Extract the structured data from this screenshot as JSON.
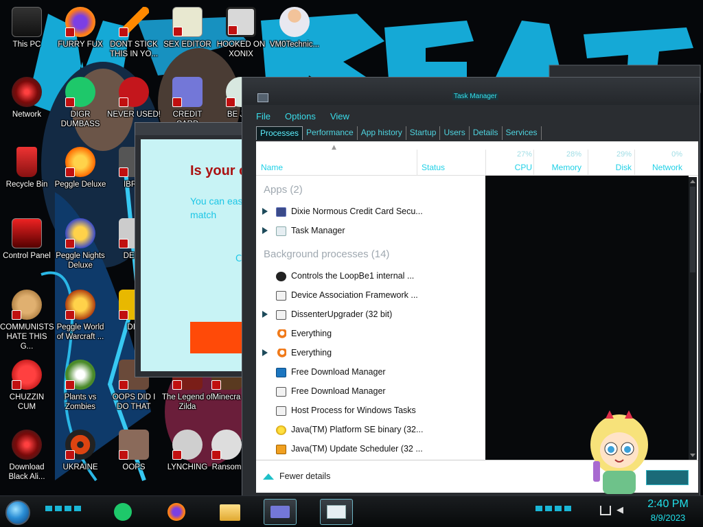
{
  "desktop": {
    "icons": [
      {
        "label": "This PC"
      },
      {
        "label": "FURRY FUX"
      },
      {
        "label": "DONT STICK THIS IN YO..."
      },
      {
        "label": "SEX EDITOR"
      },
      {
        "label": "HOOKED ON XONIX"
      },
      {
        "label": "VM0Technic..."
      },
      {
        "label": "Network"
      },
      {
        "label": "DIGR DUMBASS"
      },
      {
        "label": "NEVER USED!"
      },
      {
        "label": "CREDIT CARD"
      },
      {
        "label": "BE JUS"
      },
      {
        "label": "Recycle Bin"
      },
      {
        "label": "Peggle Deluxe"
      },
      {
        "label": "IBRAI"
      },
      {
        "label": "Control Panel"
      },
      {
        "label": "Peggle Nights Deluxe"
      },
      {
        "label": "DEEZ"
      },
      {
        "label": "COMMUNISTS HATE THIS G..."
      },
      {
        "label": "Peggle World of Warcraft ..."
      },
      {
        "label": "DIE"
      },
      {
        "label": "CHUZZIN CUM"
      },
      {
        "label": "Plants vs Zombies"
      },
      {
        "label": "OOPS DID I DO THAT"
      },
      {
        "label": "The Legend of Zilda"
      },
      {
        "label": "Minecra"
      },
      {
        "label": "Download Black Ali..."
      },
      {
        "label": "UKRAINE"
      },
      {
        "label": "OOPS"
      },
      {
        "label": "LYNCHING"
      },
      {
        "label": "Ransom"
      }
    ],
    "wallpaper_text": "NO REACT"
  },
  "background_window": {
    "heading": "Is your c",
    "body": "You can eas here and we have match",
    "small": "C"
  },
  "task_manager": {
    "title": "Task Manager",
    "menu": [
      "File",
      "Options",
      "View"
    ],
    "tabs": [
      "Processes",
      "Performance",
      "App history",
      "Startup",
      "Users",
      "Details",
      "Services"
    ],
    "active_tab": "Processes",
    "columns": {
      "name": "Name",
      "status": "Status",
      "cpu": {
        "label": "CPU",
        "pct": "27%"
      },
      "memory": {
        "label": "Memory",
        "pct": "28%"
      },
      "disk": {
        "label": "Disk",
        "pct": "29%"
      },
      "network": {
        "label": "Network",
        "pct": "0%"
      }
    },
    "groups": {
      "apps": {
        "label": "Apps (2)"
      },
      "background": {
        "label": "Background processes (14)"
      }
    },
    "apps": [
      {
        "name": "Dixie Normous Credit Card Secu...",
        "expandable": true,
        "icon": "window-icon"
      },
      {
        "name": "Task Manager",
        "expandable": true,
        "icon": "task-manager-icon"
      }
    ],
    "background": [
      {
        "name": "Controls the LoopBe1 internal ...",
        "expandable": false,
        "icon": "loopbe-icon"
      },
      {
        "name": "Device Association Framework ...",
        "expandable": false,
        "icon": "window-icon"
      },
      {
        "name": "DissenterUpgrader (32 bit)",
        "expandable": true,
        "icon": "window-icon"
      },
      {
        "name": "Everything",
        "expandable": false,
        "icon": "magnifier-icon"
      },
      {
        "name": "Everything",
        "expandable": true,
        "icon": "magnifier-icon"
      },
      {
        "name": "Free Download Manager",
        "expandable": false,
        "icon": "fdm-icon"
      },
      {
        "name": "Free Download Manager",
        "expandable": false,
        "icon": "window-icon"
      },
      {
        "name": "Host Process for Windows Tasks",
        "expandable": false,
        "icon": "window-icon"
      },
      {
        "name": "Java(TM) Platform SE binary (32...",
        "expandable": false,
        "icon": "java-icon"
      },
      {
        "name": "Java(TM) Update Scheduler (32 ...",
        "expandable": false,
        "icon": "java-update-icon"
      }
    ],
    "footer": {
      "fewer_details": "Fewer details"
    }
  },
  "taskbar": {
    "time": "2:40 PM",
    "date": "8/9/2023"
  },
  "colors": {
    "accent": "#20e0ea",
    "taskbar": "#0c0e10",
    "tm_frame": "#2a2d31"
  }
}
